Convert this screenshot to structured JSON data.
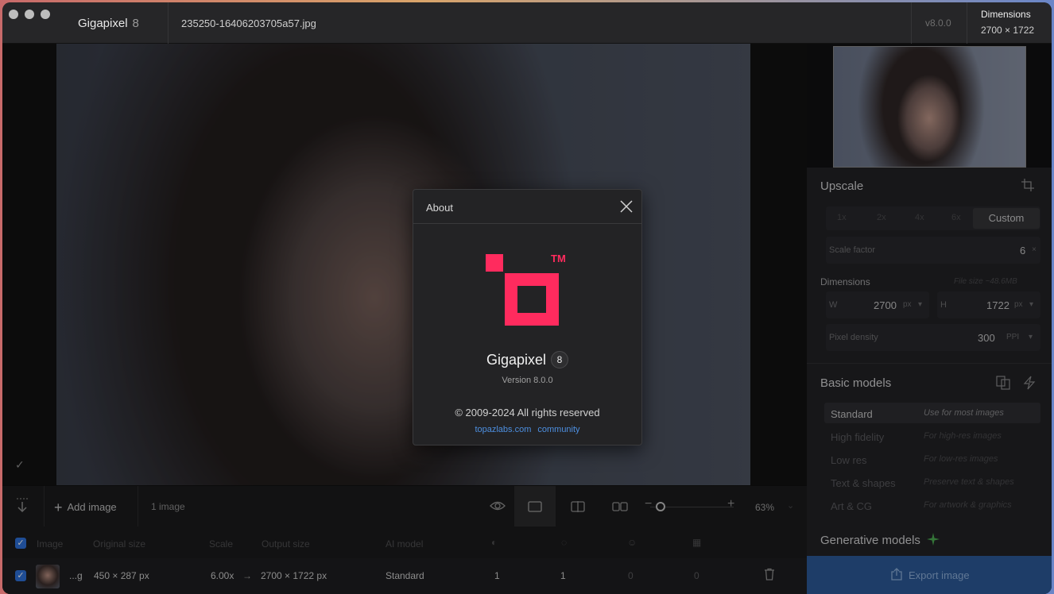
{
  "titlebar": {
    "app_name": "Gigapixel",
    "app_version": "8",
    "file_name": "235250-16406203705a57.jpg",
    "version_tag": "v8.0.0",
    "dimensions_label": "Dimensions",
    "dimensions_value": "2700 × 1722"
  },
  "toolbar": {
    "add_image_label": "Add image",
    "image_count": "1 image",
    "zoom_value": "63%"
  },
  "table": {
    "headers": [
      "Image",
      "Original size",
      "Scale",
      "Output size",
      "AI model"
    ],
    "row": {
      "name": "...g",
      "original_size": "450 × 287 px",
      "scale": "6.00x",
      "output_size": "2700 × 1722 px",
      "ai_model": "Standard",
      "col_a": "1",
      "col_b": "1",
      "col_c": "0",
      "col_d": "0"
    }
  },
  "panel": {
    "upscale_title": "Upscale",
    "scale_options": [
      "1x",
      "2x",
      "4x",
      "6x"
    ],
    "custom_label": "Custom",
    "scale_factor_label": "Scale factor",
    "scale_factor_value": "6",
    "dimensions_title": "Dimensions",
    "file_size_hint": "File size ~48.6MB",
    "width_label": "W",
    "width_value": "2700",
    "height_label": "H",
    "height_value": "1722",
    "px_unit": "px",
    "pixel_density_label": "Pixel density",
    "pixel_density_value": "300",
    "ppi_unit": "PPI",
    "basic_models_title": "Basic models",
    "models": [
      {
        "name": "Standard",
        "desc": "Use for most images"
      },
      {
        "name": "High fidelity",
        "desc": "For high-res images"
      },
      {
        "name": "Low res",
        "desc": "For low-res images"
      },
      {
        "name": "Text & shapes",
        "desc": "Preserve text & shapes"
      },
      {
        "name": "Art & CG",
        "desc": "For artwork & graphics"
      }
    ],
    "generative_models_title": "Generative models",
    "export_label": "Export image"
  },
  "dialog": {
    "title": "About",
    "trademark": "TM",
    "app_name": "Gigapixel",
    "app_badge": "8",
    "version": "Version 8.0.0",
    "copyright": "© 2009-2024 All rights reserved",
    "link_site": "topazlabs.com",
    "link_community": "community"
  },
  "colors": {
    "brand_red": "#ff2b5e",
    "accent_blue": "#2d6fd6",
    "link_blue": "#4d8fe0"
  }
}
